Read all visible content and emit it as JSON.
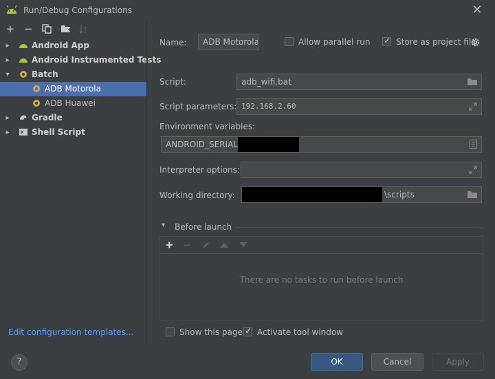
{
  "window": {
    "title": "Run/Debug Configurations",
    "close_icon": "close-icon"
  },
  "toolbar": {
    "add_glyph": "+",
    "remove_glyph": "−",
    "icons": [
      "add-icon",
      "remove-icon",
      "copy-icon",
      "folder-add-icon",
      "sort-icon"
    ]
  },
  "tree": {
    "items": [
      {
        "label": "Android App",
        "icon": "android-icon"
      },
      {
        "label": "Android Instrumented Tests",
        "icon": "android-icon"
      },
      {
        "label": "Batch",
        "icon": "gear-icon"
      },
      {
        "label": "ADB Motorola",
        "icon": "gear-icon"
      },
      {
        "label": "ADB Huawei",
        "icon": "gear-icon"
      },
      {
        "label": "Gradle",
        "icon": "gradle-icon"
      },
      {
        "label": "Shell Script",
        "icon": "terminal-icon"
      }
    ],
    "selected": "ADB Motorola",
    "edit_templates": "Edit configuration templates..."
  },
  "form": {
    "name_label": "Name:",
    "name_value": "ADB Motorola",
    "allow_parallel_label": "Allow parallel run",
    "allow_parallel_checked": false,
    "store_project_label": "Store as project file",
    "store_project_checked": true,
    "script_label": "Script:",
    "script_value": "adb_wifi.bat",
    "params_label": "Script parameters:",
    "params_value": "192.168.2.60",
    "env_label": "Environment variables:",
    "env_value": "ANDROID_SERIAL=",
    "interp_label": "Interpreter options:",
    "interp_value": "",
    "workdir_label": "Working directory:",
    "workdir_value": "\\scripts"
  },
  "before_launch": {
    "title": "Before launch",
    "empty_text": "There are no tasks to run before launch",
    "add_glyph": "+",
    "remove_glyph": "−"
  },
  "footer": {
    "show_page_label": "Show this page",
    "show_page_checked": false,
    "activate_tool_label": "Activate tool window",
    "activate_tool_checked": true,
    "help_glyph": "?",
    "ok_label": "OK",
    "cancel_label": "Cancel",
    "apply_label": "Apply"
  },
  "colors": {
    "background": "#3c3f41",
    "selection": "#4b6eaf",
    "primary_button": "#365880",
    "android_green": "#a4c639",
    "link": "#589df6"
  }
}
